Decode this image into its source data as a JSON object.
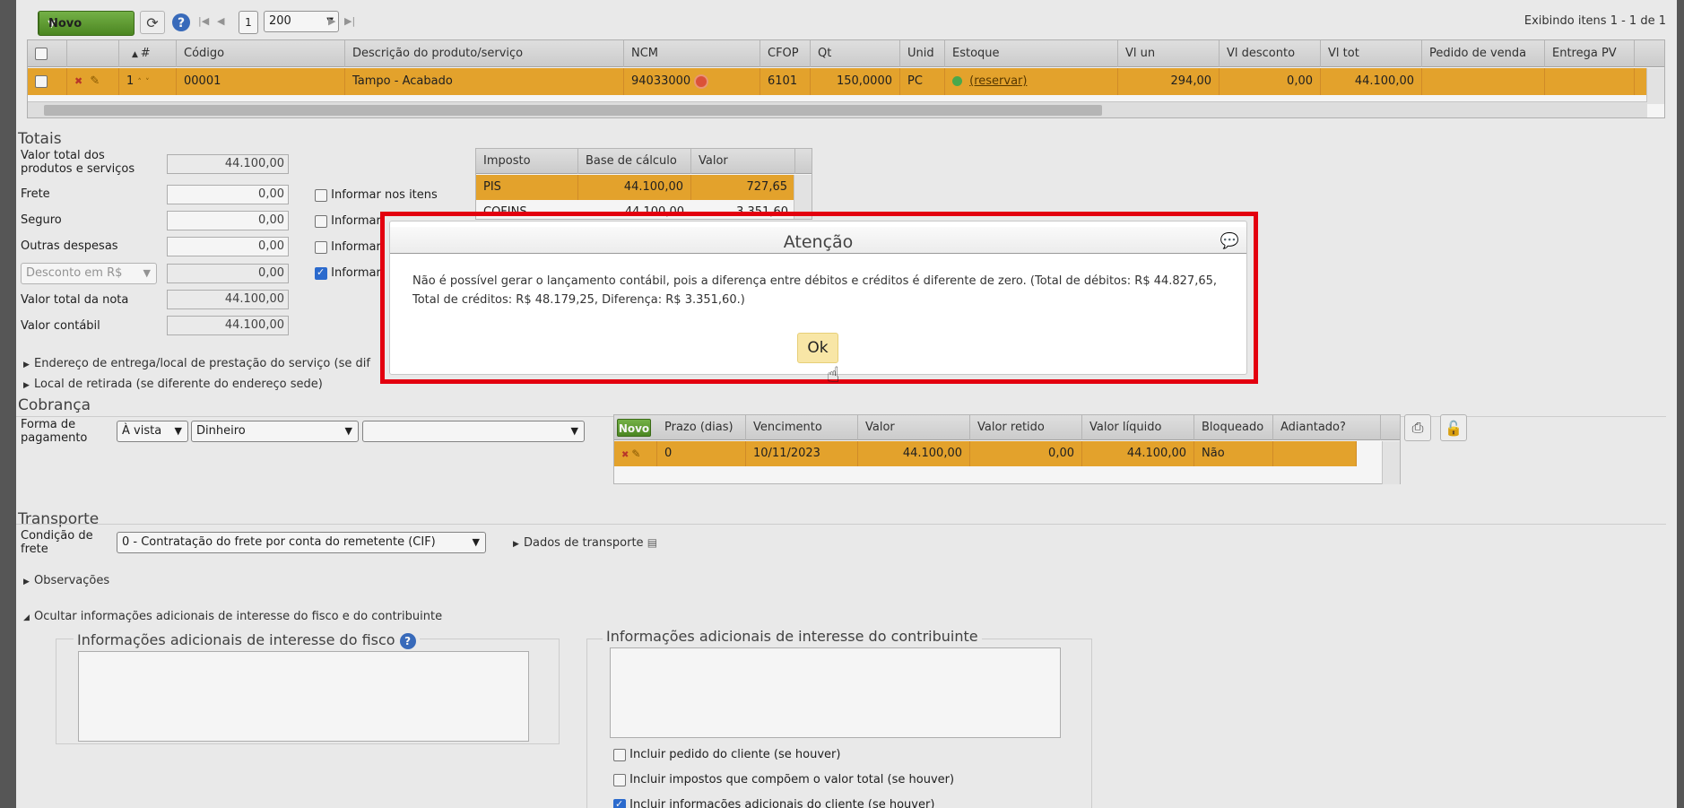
{
  "toolbar": {
    "new_label": "Novo",
    "page": "1",
    "page_size": "200",
    "items_info": "Exibindo itens 1 - 1 de 1"
  },
  "items_grid": {
    "columns": [
      "#",
      "Código",
      "Descrição do produto/serviço",
      "NCM",
      "CFOP",
      "Qt",
      "Unid",
      "Estoque",
      "Vl un",
      "Vl desconto",
      "Vl tot",
      "Pedido de venda",
      "Entrega PV"
    ],
    "rows": [
      {
        "num": "1",
        "codigo": "00001",
        "descricao": "Tampo - Acabado",
        "ncm": "94033000",
        "cfop": "6101",
        "qt": "150,0000",
        "unid": "PC",
        "estoque": "(reservar)",
        "vl_un": "294,00",
        "vl_desconto": "0,00",
        "vl_tot": "44.100,00",
        "pedido": "",
        "entrega": ""
      }
    ]
  },
  "totais": {
    "title": "Totais",
    "valor_total_label": "Valor total dos produtos e serviços",
    "valor_total": "44.100,00",
    "frete_label": "Frete",
    "frete": "0,00",
    "seguro_label": "Seguro",
    "seguro": "0,00",
    "outras_label": "Outras despesas",
    "outras": "0,00",
    "desconto_select": "Desconto em R$",
    "desconto": "0,00",
    "total_nota_label": "Valor total da nota",
    "total_nota": "44.100,00",
    "contabil_label": "Valor contábil",
    "contabil": "44.100,00",
    "informar_itens": "Informar nos itens",
    "informar_cut": "Informar"
  },
  "tax_table": {
    "columns": [
      "Imposto",
      "Base de cálculo",
      "Valor"
    ],
    "rows": [
      {
        "imposto": "PIS",
        "base": "44.100,00",
        "valor": "727,65"
      },
      {
        "imposto": "COFINS",
        "base": "44.100,00",
        "valor": "3.351,60"
      }
    ]
  },
  "disclosures": {
    "endereco": "Endereço de entrega/local de prestação do serviço (se dif",
    "retirada": "Local de retirada (se diferente do endereço sede)",
    "observacoes": "Observações",
    "ocultar": "Ocultar informações adicionais de interesse do fisco e do contribuinte",
    "dados_transporte": "Dados de transporte"
  },
  "cobranca": {
    "title": "Cobrança",
    "forma_label": "Forma de pagamento",
    "a_vista": "À vista",
    "dinheiro": "Dinheiro",
    "third": "",
    "grid_new": "Novo",
    "columns": [
      "Prazo (dias)",
      "Vencimento",
      "Valor",
      "Valor retido",
      "Valor líquido",
      "Bloqueado",
      "Adiantado?"
    ],
    "rows": [
      {
        "prazo": "0",
        "vencimento": "10/11/2023",
        "valor": "44.100,00",
        "retido": "0,00",
        "liquido": "44.100,00",
        "bloqueado": "Não",
        "adiantado": ""
      }
    ]
  },
  "transporte": {
    "title": "Transporte",
    "condicao_label": "Condição de frete",
    "condicao": "0 - Contratação do frete por conta do remetente (CIF)"
  },
  "info_adicional": {
    "fisco_title": "Informações adicionais de interesse do fisco",
    "contribuinte_title": "Informações adicionais de interesse do contribuinte",
    "check_pedido": "Incluir pedido do cliente (se houver)",
    "check_impostos": "Incluir impostos que compõem o valor total (se houver)",
    "check_info": "Incluir informações adicionais do cliente (se houver)"
  },
  "dialog": {
    "title": "Atenção",
    "message": "Não é possível gerar o lançamento contábil, pois a diferença entre débitos e créditos é diferente de zero. (Total de débitos: R$ 44.827,65, Total de créditos: R$ 48.179,25, Diferença: R$ 3.351,60.)",
    "ok": "Ok"
  },
  "colors": {
    "row_highlight": "#eda92e",
    "green_button": "#5b9a2c",
    "frame_red": "#e3000f",
    "ok_button": "#f8e6a6"
  }
}
